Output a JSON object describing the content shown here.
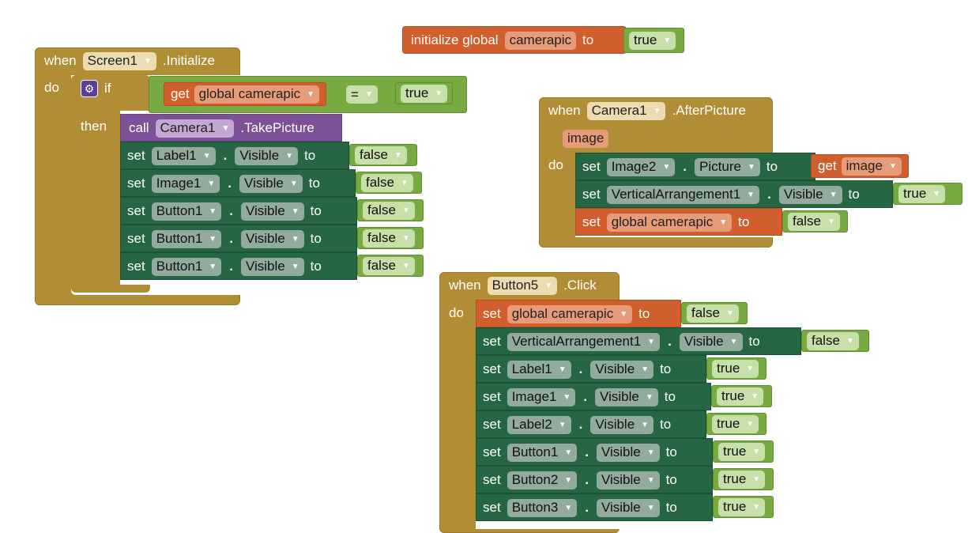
{
  "colors": {
    "event": "#b18e35",
    "variable": "#d05f2d",
    "component": "#266643",
    "method": "#7d5197",
    "logic": "#77ab41"
  },
  "dropdown_icon": "triangle-down-icon",
  "init_global": {
    "label": "initialize global",
    "name": "camerapic",
    "to": "to",
    "value": "true"
  },
  "screen_init": {
    "when": "when",
    "component": "Screen1",
    "event": ".Initialize",
    "do": "do",
    "if": "if",
    "then": "then",
    "cond_get": "get",
    "cond_var": "global camerapic",
    "cond_op": "=",
    "cond_val": "true",
    "call": "call",
    "call_component": "Camera1",
    "call_method": ".TakePicture",
    "sets": [
      {
        "set": "set",
        "component": "Label1",
        "dot": ".",
        "prop": "Visible",
        "to": "to",
        "value": "false"
      },
      {
        "set": "set",
        "component": "Image1",
        "dot": ".",
        "prop": "Visible",
        "to": "to",
        "value": "false"
      },
      {
        "set": "set",
        "component": "Button1",
        "dot": ".",
        "prop": "Visible",
        "to": "to",
        "value": "false"
      },
      {
        "set": "set",
        "component": "Button1",
        "dot": ".",
        "prop": "Visible",
        "to": "to",
        "value": "false"
      },
      {
        "set": "set",
        "component": "Button1",
        "dot": ".",
        "prop": "Visible",
        "to": "to",
        "value": "false"
      }
    ]
  },
  "after_picture": {
    "when": "when",
    "component": "Camera1",
    "event": ".AfterPicture",
    "param": "image",
    "do": "do",
    "row1": {
      "set": "set",
      "component": "Image2",
      "dot": ".",
      "prop": "Picture",
      "to": "to",
      "get": "get",
      "var": "image"
    },
    "row2": {
      "set": "set",
      "component": "VerticalArrangement1",
      "dot": ".",
      "prop": "Visible",
      "to": "to",
      "value": "true"
    },
    "row3": {
      "set": "set",
      "var": "global camerapic",
      "to": "to",
      "value": "false"
    }
  },
  "button5_click": {
    "when": "when",
    "component": "Button5",
    "event": ".Click",
    "do": "do",
    "row0": {
      "set": "set",
      "var": "global camerapic",
      "to": "to",
      "value": "false"
    },
    "sets": [
      {
        "set": "set",
        "component": "VerticalArrangement1",
        "dot": ".",
        "prop": "Visible",
        "to": "to",
        "value": "false"
      },
      {
        "set": "set",
        "component": "Label1",
        "dot": ".",
        "prop": "Visible",
        "to": "to",
        "value": "true"
      },
      {
        "set": "set",
        "component": "Image1",
        "dot": ".",
        "prop": "Visible",
        "to": "to",
        "value": "true"
      },
      {
        "set": "set",
        "component": "Label2",
        "dot": ".",
        "prop": "Visible",
        "to": "to",
        "value": "true"
      },
      {
        "set": "set",
        "component": "Button1",
        "dot": ".",
        "prop": "Visible",
        "to": "to",
        "value": "true"
      },
      {
        "set": "set",
        "component": "Button2",
        "dot": ".",
        "prop": "Visible",
        "to": "to",
        "value": "true"
      },
      {
        "set": "set",
        "component": "Button3",
        "dot": ".",
        "prop": "Visible",
        "to": "to",
        "value": "true"
      }
    ]
  }
}
